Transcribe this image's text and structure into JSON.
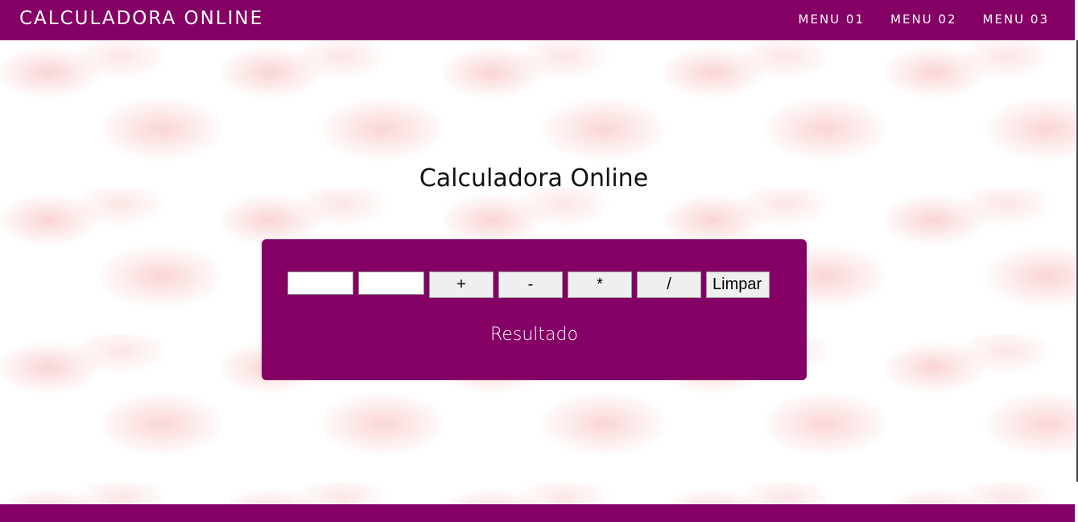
{
  "header": {
    "brand": "CALCULADORA ONLINE",
    "menu": [
      "MENU 01",
      "MENU 02",
      "MENU 03"
    ]
  },
  "main": {
    "title": "Calculadora Online",
    "inputs": [
      {
        "value": "",
        "placeholder": ""
      },
      {
        "value": "",
        "placeholder": ""
      }
    ],
    "buttons": {
      "add": "+",
      "subtract": "-",
      "multiply": "*",
      "divide": "/",
      "clear": "Limpar"
    },
    "result_label": "Resultado"
  },
  "colors": {
    "brand": "#850065",
    "text_light": "#ffffff",
    "background": "#ffffff"
  }
}
